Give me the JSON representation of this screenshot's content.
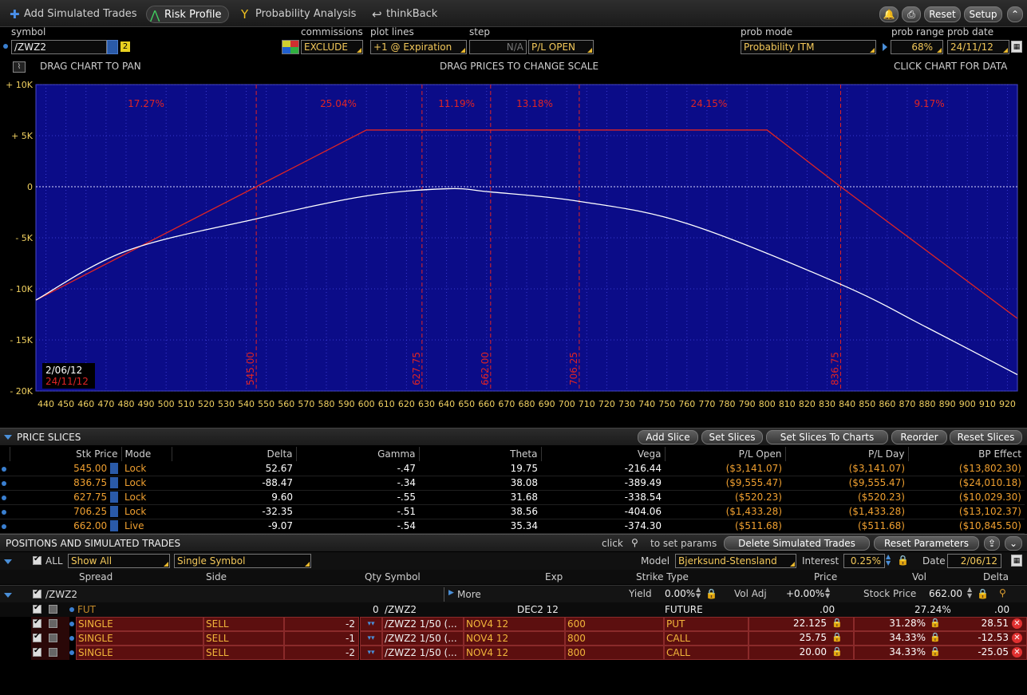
{
  "tabs": [
    {
      "label": "Add Simulated Trades",
      "icon": "plus-icon"
    },
    {
      "label": "Risk Profile",
      "icon": "risk-profile-icon"
    },
    {
      "label": "Probability Analysis",
      "icon": "probability-icon"
    },
    {
      "label": "thinkBack",
      "icon": "thinkback-icon"
    }
  ],
  "toolbar": {
    "reset": "Reset",
    "setup": "Setup"
  },
  "controls": {
    "symbol_label": "symbol",
    "symbol": "/ZWZ2",
    "symbol_badge": "2",
    "commissions_label": "commissions",
    "commissions": "EXCLUDE",
    "plot_lines_label": "plot lines",
    "plot_lines": "+1 @ Expiration",
    "step_label": "step",
    "step": "N/A",
    "pl_mode": "P/L OPEN",
    "prob_mode_label": "prob mode",
    "prob_mode": "Probability ITM",
    "prob_range_label": "prob range",
    "prob_range": "68%",
    "prob_date_label": "prob date",
    "prob_date": "24/11/12"
  },
  "chart_info": {
    "left": "DRAG CHART TO PAN",
    "center": "DRAG PRICES TO CHANGE SCALE",
    "right": "CLICK CHART FOR DATA"
  },
  "chart_data": {
    "type": "line",
    "xlim": [
      435,
      925
    ],
    "ylim": [
      -20000,
      10000
    ],
    "x_ticks": [
      440,
      450,
      460,
      470,
      480,
      490,
      500,
      510,
      520,
      530,
      540,
      550,
      560,
      570,
      580,
      590,
      600,
      610,
      620,
      630,
      640,
      650,
      660,
      670,
      680,
      690,
      700,
      710,
      720,
      730,
      740,
      750,
      760,
      770,
      780,
      790,
      800,
      810,
      820,
      830,
      840,
      850,
      860,
      870,
      880,
      890,
      900,
      910,
      920
    ],
    "y_ticks": [
      {
        "v": 10000,
        "t": "+ 10K"
      },
      {
        "v": 5000,
        "t": "+ 5K"
      },
      {
        "v": 0,
        "t": "0"
      },
      {
        "v": -5000,
        "t": "- 5K"
      },
      {
        "v": -10000,
        "t": "- 10K"
      },
      {
        "v": -15000,
        "t": "- 15K"
      },
      {
        "v": -20000,
        "t": "- 20K"
      }
    ],
    "series": [
      {
        "name": "24/11/12",
        "color": "#e02424",
        "x": [
          435,
          545,
          600,
          800,
          836.75,
          925
        ],
        "y": [
          -11100,
          0,
          5550,
          5550,
          0,
          -12900
        ]
      },
      {
        "name": "2/06/12",
        "color": "#ffffff",
        "x": [
          435,
          480,
          545,
          600,
          640,
          662,
          706.25,
          760,
          836.75,
          880,
          925
        ],
        "y": [
          -11100,
          -6300,
          -3141,
          -900,
          -200,
          -512,
          -1433,
          -3600,
          -9555,
          -13800,
          -18400
        ]
      }
    ],
    "slices": [
      {
        "x": 545.0,
        "label": "545.00"
      },
      {
        "x": 627.75,
        "label": "627.75"
      },
      {
        "x": 662.0,
        "label": "662.00"
      },
      {
        "x": 706.25,
        "label": "706.25"
      },
      {
        "x": 836.75,
        "label": "836.75"
      }
    ],
    "probabilities": [
      {
        "x": 490,
        "label": "17.27%"
      },
      {
        "x": 586,
        "label": "25.04%"
      },
      {
        "x": 645,
        "label": "11.19%"
      },
      {
        "x": 684,
        "label": "13.18%"
      },
      {
        "x": 771,
        "label": "24.15%"
      },
      {
        "x": 881,
        "label": "9.17%"
      }
    ],
    "legend_dates": [
      "2/06/12",
      "24/11/12"
    ],
    "grid": true
  },
  "price_slices": {
    "title": "PRICE SLICES",
    "buttons": [
      "Add Slice",
      "Set Slices",
      "Set Slices To Charts",
      "Reorder",
      "Reset Slices"
    ],
    "headers": [
      "Stk Price",
      "Mode",
      "Delta",
      "Gamma",
      "Theta",
      "Vega",
      "P/L Open",
      "P/L Day",
      "BP Effect"
    ],
    "rows": [
      [
        "545.00",
        "Lock",
        "52.67",
        "-.47",
        "19.75",
        "-216.44",
        "($3,141.07)",
        "($3,141.07)",
        "($13,802.30)"
      ],
      [
        "836.75",
        "Lock",
        "-88.47",
        "-.34",
        "38.08",
        "-389.49",
        "($9,555.47)",
        "($9,555.47)",
        "($24,010.18)"
      ],
      [
        "627.75",
        "Lock",
        "9.60",
        "-.55",
        "31.68",
        "-338.54",
        "($520.23)",
        "($520.23)",
        "($10,029.30)"
      ],
      [
        "706.25",
        "Lock",
        "-32.35",
        "-.51",
        "38.56",
        "-404.06",
        "($1,433.28)",
        "($1,433.28)",
        "($13,102.37)"
      ],
      [
        "662.00",
        "Live",
        "-9.07",
        "-.54",
        "35.34",
        "-374.30",
        "($511.68)",
        "($511.68)",
        "($10,845.50)"
      ]
    ]
  },
  "positions": {
    "title": "POSITIONS AND SIMULATED TRADES",
    "click_text": "click",
    "params_text": "to set params",
    "buttons": [
      "Delete Simulated Trades",
      "Reset Parameters"
    ],
    "all_label": "ALL",
    "show": "Show All",
    "mode": "Single Symbol",
    "model_label": "Model",
    "model": "Bjerksund-Stensland",
    "interest_label": "Interest",
    "interest": "0.25%",
    "date_label": "Date",
    "date": "2/06/12",
    "headers": {
      "spread": "Spread",
      "side": "Side",
      "qty_symbol": "Qty Symbol",
      "exp": "Exp",
      "strike_type": "Strike Type",
      "price": "Price",
      "vol": "Vol",
      "delta": "Delta"
    },
    "group": {
      "symbol": "/ZWZ2",
      "more": "More",
      "yield_label": "Yield",
      "yield": "0.00%",
      "voladj_label": "Vol Adj",
      "voladj": "+0.00%",
      "stock_label": "Stock Price",
      "stock": "662.00"
    },
    "fut": {
      "spread": "FUT",
      "qty": "0",
      "symbol": "/ZWZ2",
      "exp": "DEC2 12",
      "type": "FUTURE",
      "price": ".00",
      "vol": "27.24%",
      "delta": ".00"
    },
    "rows": [
      {
        "spread": "SINGLE",
        "side": "SELL",
        "qty": "-2",
        "symbol": "/ZWZ2 1/50 (...",
        "exp": "NOV4 12",
        "strike": "600",
        "type": "PUT",
        "price": "22.125",
        "vol": "31.28%",
        "delta": "28.51"
      },
      {
        "spread": "SINGLE",
        "side": "SELL",
        "qty": "-1",
        "symbol": "/ZWZ2 1/50 (...",
        "exp": "NOV4 12",
        "strike": "800",
        "type": "CALL",
        "price": "25.75",
        "vol": "34.33%",
        "delta": "-12.53"
      },
      {
        "spread": "SINGLE",
        "side": "SELL",
        "qty": "-2",
        "symbol": "/ZWZ2 1/50 (...",
        "exp": "NOV4 12",
        "strike": "800",
        "type": "CALL",
        "price": "20.00",
        "vol": "34.33%",
        "delta": "-25.05"
      }
    ]
  }
}
